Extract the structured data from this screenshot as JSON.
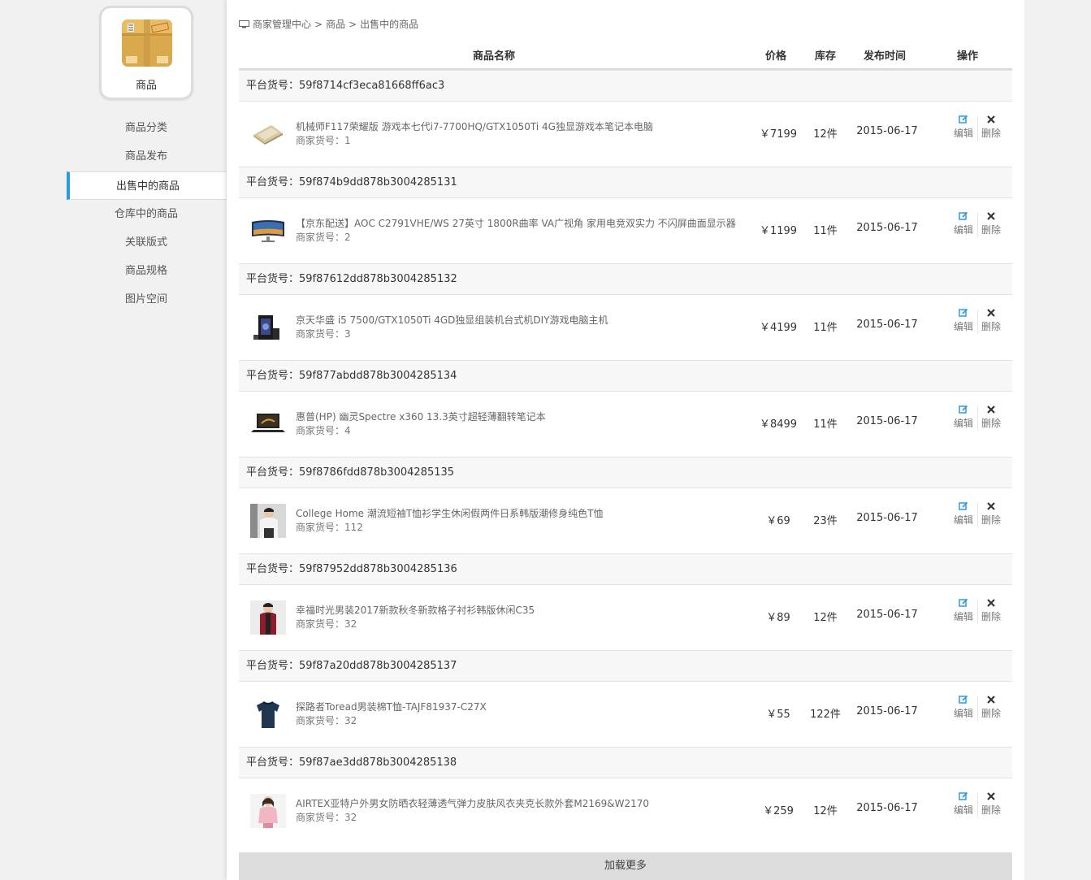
{
  "sidebar": {
    "module_label": "商品",
    "module_icon": "package-box-icon",
    "items": [
      {
        "label": "商品分类",
        "active": false
      },
      {
        "label": "商品发布",
        "active": false
      },
      {
        "label": "出售中的商品",
        "active": true
      },
      {
        "label": "仓库中的商品",
        "active": false
      },
      {
        "label": "关联版式",
        "active": false
      },
      {
        "label": "商品规格",
        "active": false
      },
      {
        "label": "图片空间",
        "active": false
      }
    ]
  },
  "breadcrumb": [
    "商家管理中心",
    "商品",
    "出售中的商品"
  ],
  "breadcrumb_sep": ">",
  "table": {
    "headers": {
      "name": "商品名称",
      "price": "价格",
      "stock": "库存",
      "date": "发布时间",
      "ops": "操作"
    },
    "edit_label": "编辑",
    "delete_label": "删除",
    "orders": [
      {
        "order_no": "平台货号：59f8714cf3eca81668ff6ac3",
        "name": "机械师F117荣耀版 游戏本七代i7-7700HQ/GTX1050Ti 4G独显游戏本笔记本电脑",
        "code": "商家货号：1",
        "price": "￥7199",
        "stock": "12件",
        "date": "2015-06-17",
        "thumb": "laptop-gold"
      },
      {
        "order_no": "平台货号：59f874b9dd878b3004285131",
        "name": "【京东配送】AOC C2791VHE/WS 27英寸 1800R曲率 VA广视角 家用电竞双实力 不闪屏曲面显示器",
        "code": "商家货号：2",
        "price": "￥1199",
        "stock": "11件",
        "date": "2015-06-17",
        "thumb": "monitor"
      },
      {
        "order_no": "平台货号：59f87612dd878b3004285132",
        "name": "京天华盛 i5 7500/GTX1050Ti 4GD独显组装机台式机DIY游戏电脑主机",
        "code": "商家货号：3",
        "price": "￥4199",
        "stock": "11件",
        "date": "2015-06-17",
        "thumb": "desktop-case"
      },
      {
        "order_no": "平台货号：59f877abdd878b3004285134",
        "name": "惠普(HP) 幽灵Spectre x360 13.3英寸超轻薄翻转笔记本",
        "code": "商家货号：4",
        "price": "￥8499",
        "stock": "11件",
        "date": "2015-06-17",
        "thumb": "laptop-dark"
      },
      {
        "order_no": "平台货号：59f8786fdd878b3004285135",
        "name": "College Home 潮流短袖T恤衫学生休闲假两件日系韩版潮修身纯色T恤",
        "code": "商家货号：112",
        "price": "￥69",
        "stock": "23件",
        "date": "2015-06-17",
        "thumb": "man-white-tee"
      },
      {
        "order_no": "平台货号：59f87952dd878b3004285136",
        "name": "幸福时光男装2017新款秋冬新款格子衬衫韩版休闲C35",
        "code": "商家货号：32",
        "price": "￥89",
        "stock": "12件",
        "date": "2015-06-17",
        "thumb": "man-red-shirt"
      },
      {
        "order_no": "平台货号：59f87a20dd878b3004285137",
        "name": "探路者Toread男装棉T恤-TAJF81937-C27X",
        "code": "商家货号：32",
        "price": "￥55",
        "stock": "122件",
        "date": "2015-06-17",
        "thumb": "navy-tee"
      },
      {
        "order_no": "平台货号：59f87ae3dd878b3004285138",
        "name": "AIRTEX亚特户外男女防晒衣轻薄透气弹力皮肤风衣夹克长款外套M2169&W2170",
        "code": "商家货号：32",
        "price": "￥259",
        "stock": "12件",
        "date": "2015-06-17",
        "thumb": "woman-pink-jacket"
      }
    ]
  },
  "load_more": "加载更多",
  "colors": {
    "accent": "#2d9ae0",
    "row_bg": "#f7f7f7",
    "loadmore_bg": "#dcdcdc"
  }
}
